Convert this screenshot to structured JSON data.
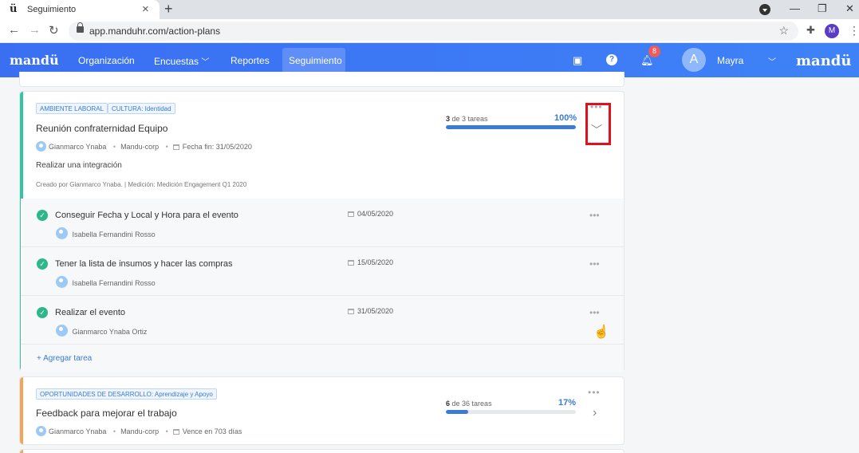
{
  "browser": {
    "tab_title": "Seguimiento",
    "tab_favicon": "ü",
    "url": "app.manduhr.com/action-plans",
    "profile_initial": "M"
  },
  "navbar": {
    "brand": "mandü",
    "items": [
      {
        "label": "Organización"
      },
      {
        "label": "Encuestas"
      },
      {
        "label": "Reportes"
      },
      {
        "label": "Seguimiento",
        "active": true
      }
    ],
    "notification_count": "8",
    "user_initial": "A",
    "user_name": "Mayra",
    "brand_right": "mandü",
    "color": "#3f7ef5"
  },
  "plans": [
    {
      "tags": [
        "AMBIENTE LABORAL",
        "CULTURA: Identidad"
      ],
      "title": "Reunión confraternidad Equipo",
      "owner": "Gianmarco Ynaba",
      "company": "Mandu-corp",
      "date_label": "Fecha fin: 31/05/2020",
      "description": "Realizar una integración",
      "created": "Creado por Gianmarco Ynaba. | Medición: Medición Engagement Q1 2020",
      "progress_done": "3",
      "progress_rest": "de 3 tareas",
      "progress_pct": "100%",
      "progress_fraction": 1.0,
      "accent": "#34c6a0",
      "expanded": true,
      "tasks": [
        {
          "title": "Conseguir Fecha y Local y Hora para el evento",
          "assignee": "Isabella Fernandini Rosso",
          "date": "04/05/2020"
        },
        {
          "title": "Tener la lista de insumos y hacer las compras",
          "assignee": "Isabella Fernandini Rosso",
          "date": "15/05/2020"
        },
        {
          "title": "Realizar el evento",
          "assignee": "Gianmarco Ynaba Ortiz",
          "date": "31/05/2020"
        }
      ],
      "add_task_label": "+ Agregar tarea"
    },
    {
      "tags": [
        "OPORTUNIDADES DE DESARROLLO: Aprendizaje y Apoyo"
      ],
      "title": "Feedback para mejorar el trabajo",
      "owner": "Gianmarco Ynaba",
      "company": "Mandu-corp",
      "date_label": "Vence en 703 días",
      "progress_done": "6",
      "progress_rest": "de 36 tareas",
      "progress_pct": "17%",
      "progress_fraction": 0.17,
      "accent": "#f5a55a",
      "expanded": false
    }
  ]
}
